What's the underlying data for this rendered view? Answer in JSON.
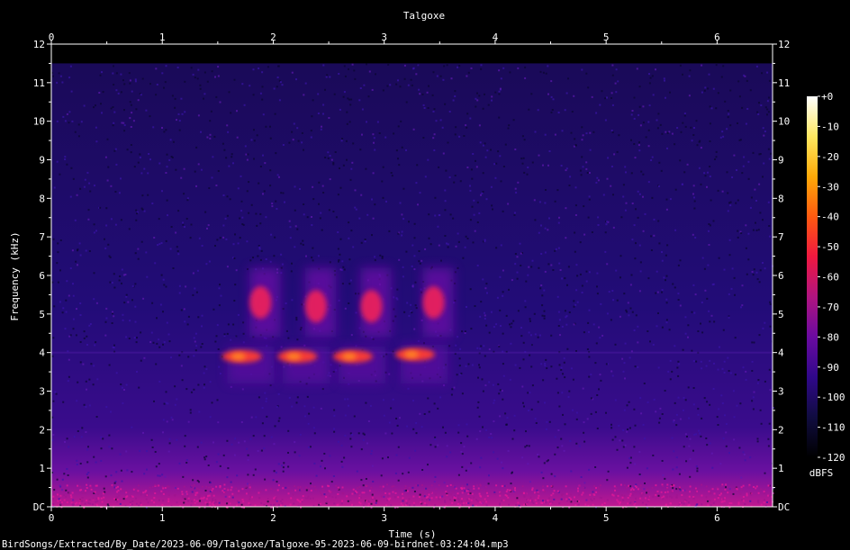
{
  "chart_data": {
    "type": "heatmap",
    "title": "Talgoxe",
    "xlabel": "Time (s)",
    "ylabel": "Frequency (kHz)",
    "xlim": [
      0,
      6.5
    ],
    "ylim": [
      0,
      12
    ],
    "x_ticks": [
      "0",
      "1",
      "2",
      "3",
      "4",
      "5",
      "6"
    ],
    "y_ticks": [
      "DC",
      "1",
      "2",
      "3",
      "4",
      "5",
      "6",
      "7",
      "8",
      "9",
      "10",
      "11",
      "12"
    ],
    "colorbar": {
      "label": "dBFS",
      "range": [
        -120,
        0
      ],
      "ticks": [
        "+0",
        "-10",
        "-20",
        "-30",
        "-40",
        "-50",
        "-60",
        "-70",
        "-80",
        "-90",
        "-100",
        "-110",
        "-120"
      ],
      "colors": [
        "#000000",
        "#100c40",
        "#30088a",
        "#6a0aa0",
        "#b01480",
        "#f01840",
        "#ff5a10",
        "#ffaa08",
        "#ffe860",
        "#ffffff"
      ]
    },
    "signal_ceiling_khz": 11.5,
    "song_phrases": [
      {
        "t": 1.62,
        "low_khz": 3.9,
        "high_khz": 5.3
      },
      {
        "t": 2.12,
        "low_khz": 3.9,
        "high_khz": 5.2
      },
      {
        "t": 2.62,
        "low_khz": 3.9,
        "high_khz": 5.2
      },
      {
        "t": 3.18,
        "low_khz": 3.95,
        "high_khz": 5.3
      }
    ],
    "footer": "BirdSongs/Extracted/By_Date/2023-06-09/Talgoxe/Talgoxe-95-2023-06-09-birdnet-03:24:04.mp3"
  }
}
